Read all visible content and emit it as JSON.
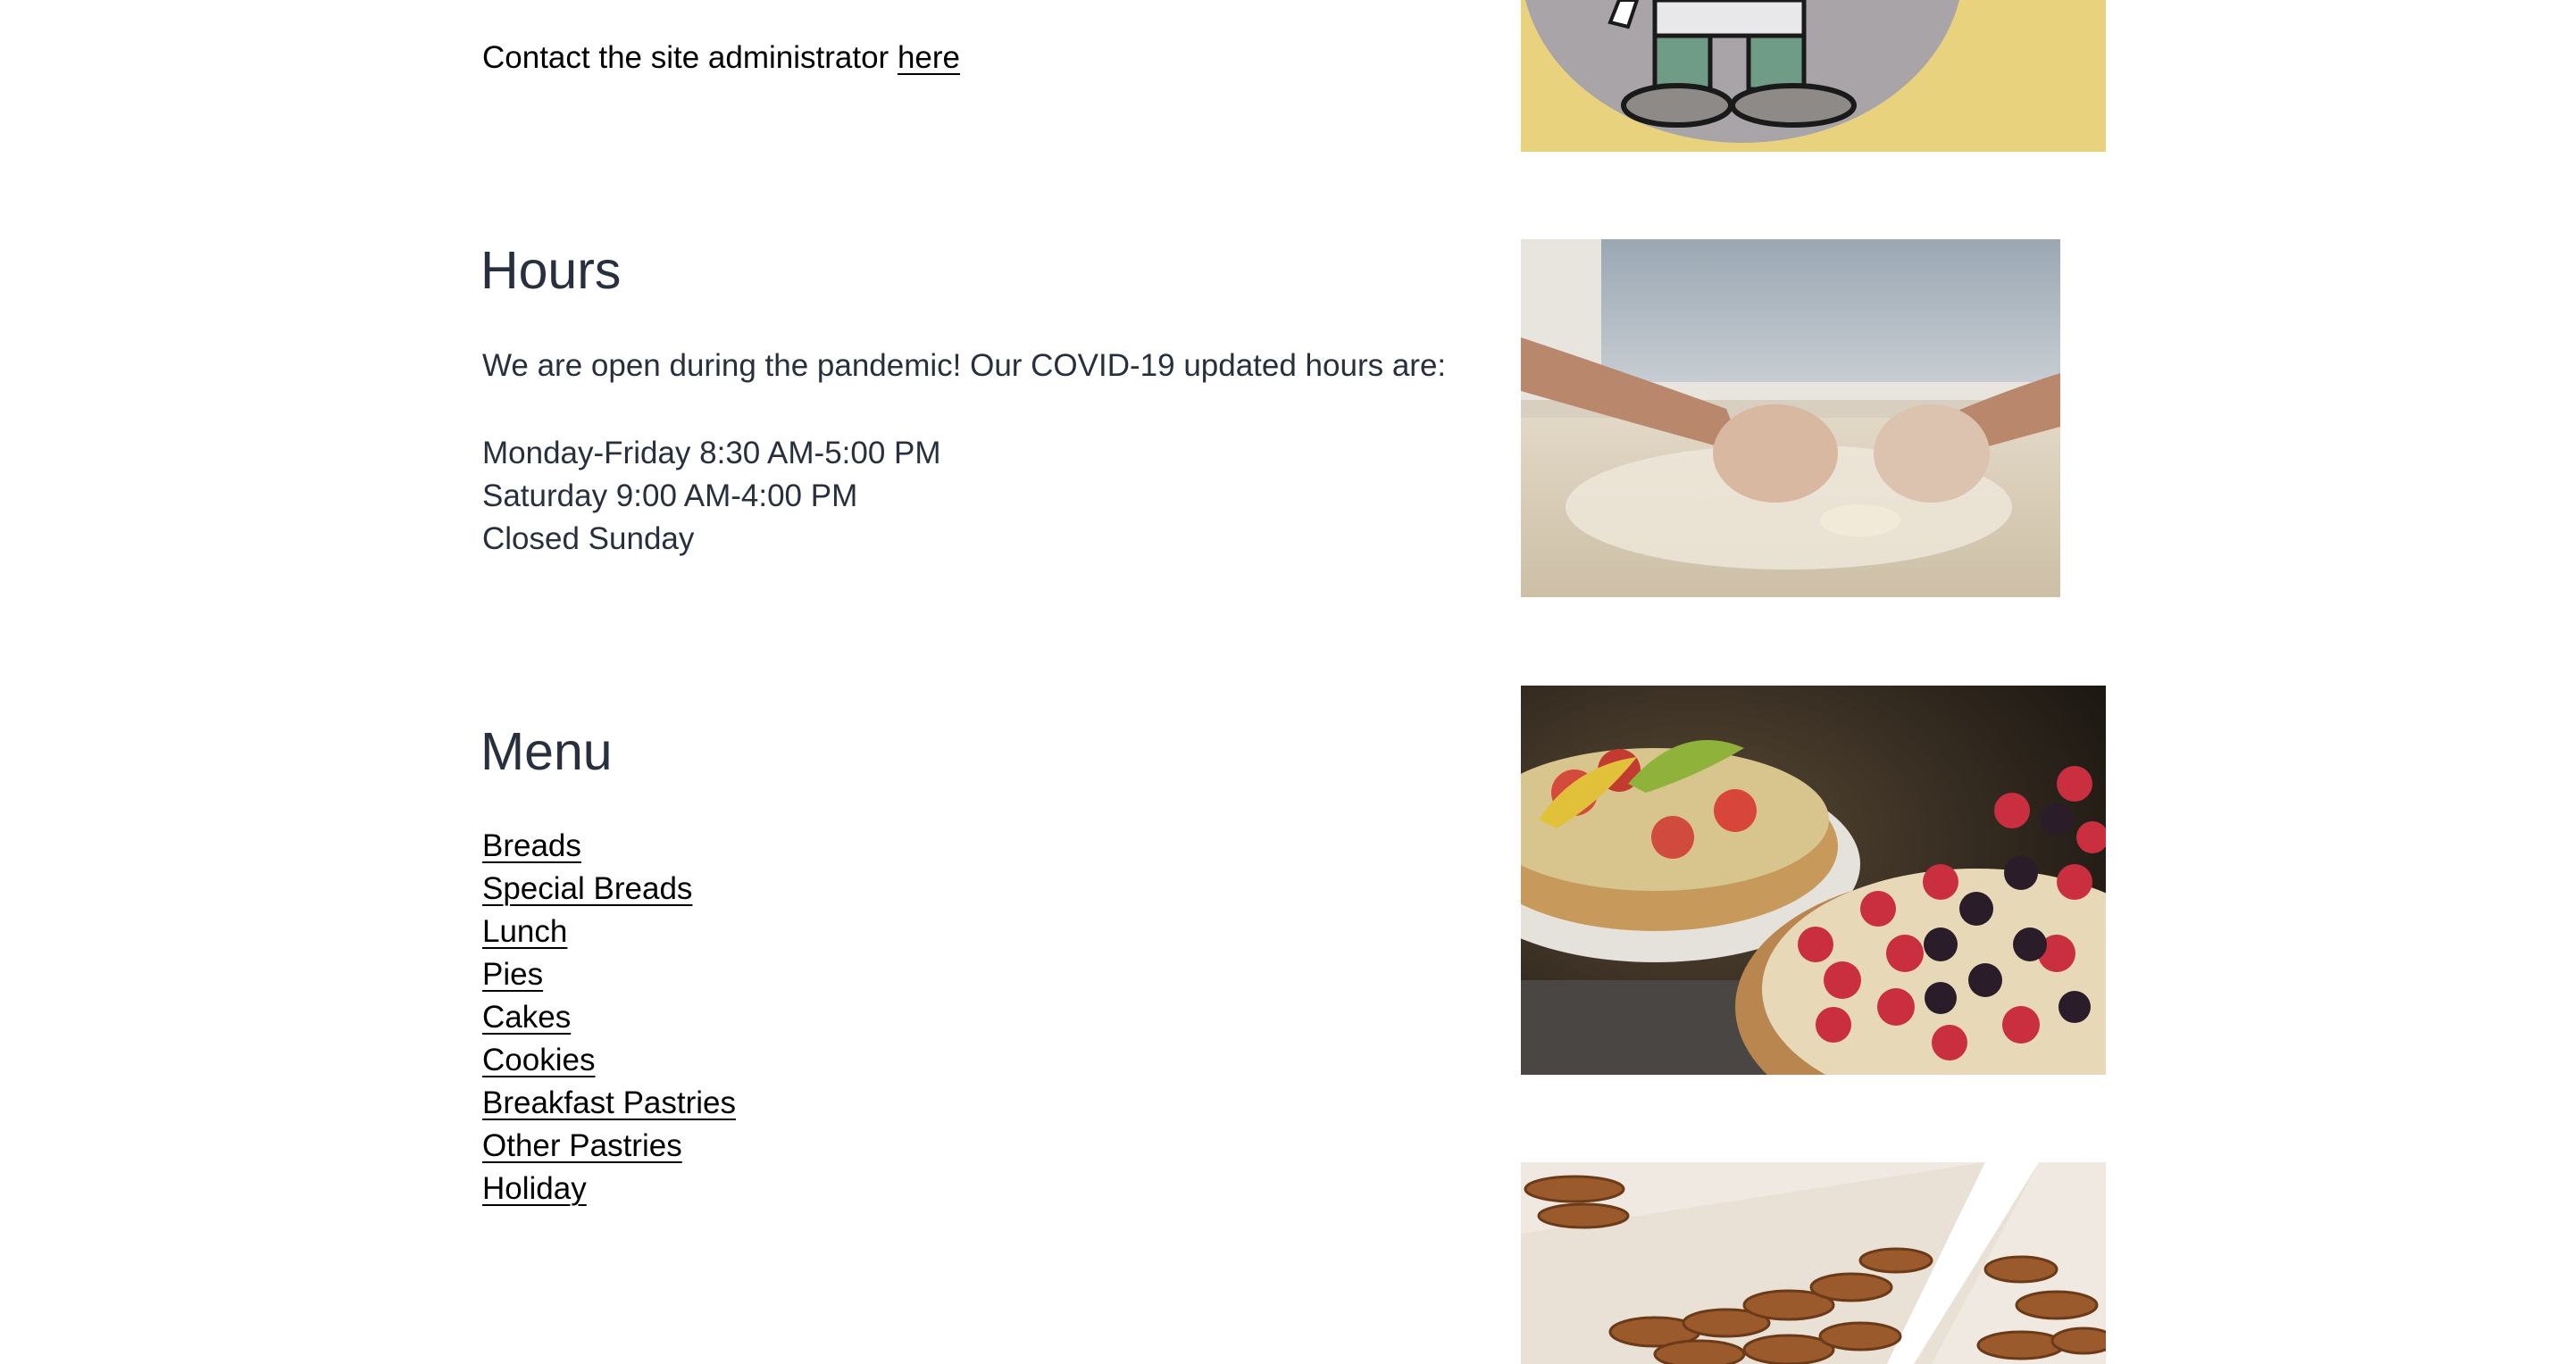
{
  "contact": {
    "text": "Contact the site administrator",
    "link_label": "here"
  },
  "hours": {
    "heading": "Hours",
    "intro": "We are open during the pandemic! Our COVID-19 updated hours are:",
    "lines": [
      "Monday-Friday 8:30 AM-5:00 PM",
      "Saturday 9:00 AM-4:00 PM",
      "Closed Sunday"
    ]
  },
  "menu": {
    "heading": "Menu",
    "items": [
      "Breads",
      "Special Breads",
      "Lunch",
      "Pies",
      "Cakes",
      "Cookies",
      "Breakfast Pastries",
      "Other Pastries",
      "Holiday"
    ]
  },
  "colors": {
    "text": "#28303d",
    "link": "#000000",
    "background": "#ffffff",
    "logo_yellow": "#e9d27e",
    "logo_circle": "#a8a4a8"
  },
  "images": [
    {
      "name": "bakery-logo-mascot"
    },
    {
      "name": "kneading-dough-photo"
    },
    {
      "name": "fruit-tarts-photo"
    },
    {
      "name": "pecan-pastries-photo"
    }
  ]
}
